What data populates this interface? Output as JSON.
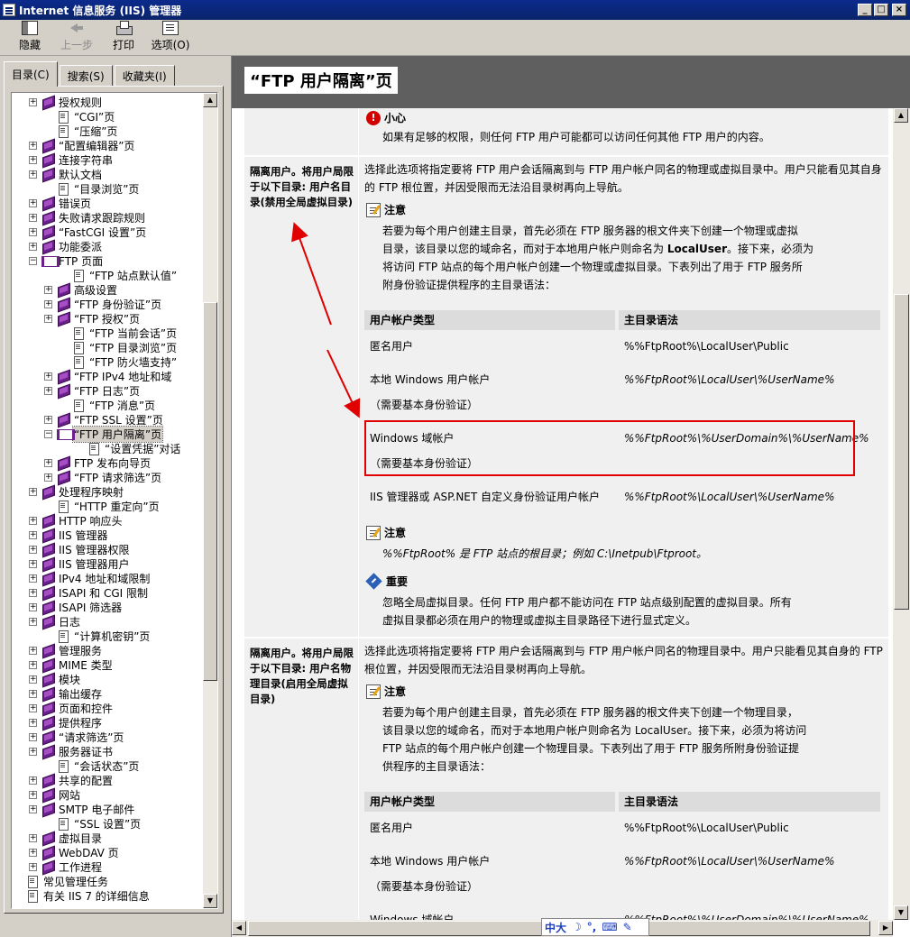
{
  "window": {
    "title": "Internet 信息服务 (IIS) 管理器",
    "min": "_",
    "max": "□",
    "close": "×"
  },
  "toolbar": {
    "hide": "隐藏",
    "back": "上一步",
    "print": "打印",
    "options": "选项(O)"
  },
  "tabs": [
    "目录(C)",
    "搜索(S)",
    "收藏夹(I)"
  ],
  "tree": [
    {
      "l": 3,
      "e": "+",
      "i": "book",
      "t": "授权规则"
    },
    {
      "l": 4,
      "e": "",
      "i": "page",
      "t": "“CGI”页"
    },
    {
      "l": 4,
      "e": "",
      "i": "page",
      "t": "“压缩”页"
    },
    {
      "l": 3,
      "e": "+",
      "i": "book",
      "t": "“配置编辑器”页"
    },
    {
      "l": 3,
      "e": "+",
      "i": "book",
      "t": "连接字符串"
    },
    {
      "l": 3,
      "e": "+",
      "i": "book",
      "t": "默认文档"
    },
    {
      "l": 4,
      "e": "",
      "i": "page",
      "t": "“目录浏览”页"
    },
    {
      "l": 3,
      "e": "+",
      "i": "book",
      "t": "错误页"
    },
    {
      "l": 3,
      "e": "+",
      "i": "book",
      "t": "失败请求跟踪规则"
    },
    {
      "l": 3,
      "e": "+",
      "i": "book",
      "t": "“FastCGI 设置”页"
    },
    {
      "l": 3,
      "e": "+",
      "i": "book",
      "t": "功能委派"
    },
    {
      "l": 3,
      "e": "-",
      "i": "openbook",
      "t": "FTP 页面"
    },
    {
      "l": 5,
      "e": "",
      "i": "page",
      "t": "“FTP 站点默认值”"
    },
    {
      "l": 4,
      "e": "+",
      "i": "book",
      "t": "高级设置"
    },
    {
      "l": 4,
      "e": "+",
      "i": "book",
      "t": "“FTP 身份验证”页"
    },
    {
      "l": 4,
      "e": "+",
      "i": "book",
      "t": "“FTP 授权”页"
    },
    {
      "l": 5,
      "e": "",
      "i": "page",
      "t": "“FTP 当前会话”页"
    },
    {
      "l": 5,
      "e": "",
      "i": "page",
      "t": "“FTP 目录浏览”页"
    },
    {
      "l": 5,
      "e": "",
      "i": "page",
      "t": "“FTP 防火墙支持”"
    },
    {
      "l": 4,
      "e": "+",
      "i": "book",
      "t": "“FTP IPv4 地址和域"
    },
    {
      "l": 4,
      "e": "+",
      "i": "book",
      "t": "“FTP 日志”页"
    },
    {
      "l": 5,
      "e": "",
      "i": "page",
      "t": "“FTP 消息”页"
    },
    {
      "l": 4,
      "e": "+",
      "i": "book",
      "t": "“FTP SSL 设置”页"
    },
    {
      "l": 4,
      "e": "-",
      "i": "openbook",
      "t": "“FTP 用户隔离”页",
      "sel": true
    },
    {
      "l": 6,
      "e": "",
      "i": "page",
      "t": "“设置凭据”对话"
    },
    {
      "l": 4,
      "e": "+",
      "i": "book",
      "t": "FTP 发布向导页"
    },
    {
      "l": 4,
      "e": "+",
      "i": "book",
      "t": "“FTP 请求筛选”页"
    },
    {
      "l": 3,
      "e": "+",
      "i": "book",
      "t": "处理程序映射"
    },
    {
      "l": 4,
      "e": "",
      "i": "page",
      "t": "“HTTP 重定向”页"
    },
    {
      "l": 3,
      "e": "+",
      "i": "book",
      "t": "HTTP 响应头"
    },
    {
      "l": 3,
      "e": "+",
      "i": "book",
      "t": "IIS 管理器"
    },
    {
      "l": 3,
      "e": "+",
      "i": "book",
      "t": "IIS 管理器权限"
    },
    {
      "l": 3,
      "e": "+",
      "i": "book",
      "t": "IIS 管理器用户"
    },
    {
      "l": 3,
      "e": "+",
      "i": "book",
      "t": "IPv4 地址和域限制"
    },
    {
      "l": 3,
      "e": "+",
      "i": "book",
      "t": "ISAPI 和 CGI 限制"
    },
    {
      "l": 3,
      "e": "+",
      "i": "book",
      "t": "ISAPI 筛选器"
    },
    {
      "l": 3,
      "e": "+",
      "i": "book",
      "t": "日志"
    },
    {
      "l": 4,
      "e": "",
      "i": "page",
      "t": "“计算机密钥”页"
    },
    {
      "l": 3,
      "e": "+",
      "i": "book",
      "t": "管理服务"
    },
    {
      "l": 3,
      "e": "+",
      "i": "book",
      "t": "MIME 类型"
    },
    {
      "l": 3,
      "e": "+",
      "i": "book",
      "t": "模块"
    },
    {
      "l": 3,
      "e": "+",
      "i": "book",
      "t": "输出缓存"
    },
    {
      "l": 3,
      "e": "+",
      "i": "book",
      "t": "页面和控件"
    },
    {
      "l": 3,
      "e": "+",
      "i": "book",
      "t": "提供程序"
    },
    {
      "l": 3,
      "e": "+",
      "i": "book",
      "t": "“请求筛选”页"
    },
    {
      "l": 3,
      "e": "+",
      "i": "book",
      "t": "服务器证书"
    },
    {
      "l": 4,
      "e": "",
      "i": "page",
      "t": "“会话状态”页"
    },
    {
      "l": 3,
      "e": "+",
      "i": "book",
      "t": "共享的配置"
    },
    {
      "l": 3,
      "e": "+",
      "i": "book",
      "t": "网站"
    },
    {
      "l": 3,
      "e": "+",
      "i": "book",
      "t": "SMTP 电子邮件"
    },
    {
      "l": 4,
      "e": "",
      "i": "page",
      "t": "“SSL 设置”页"
    },
    {
      "l": 3,
      "e": "+",
      "i": "book",
      "t": "虚拟目录"
    },
    {
      "l": 3,
      "e": "+",
      "i": "book",
      "t": "WebDAV 页"
    },
    {
      "l": 3,
      "e": "+",
      "i": "book",
      "t": "工作进程"
    },
    {
      "l": 2,
      "e": "",
      "i": "page",
      "t": "常见管理任务"
    },
    {
      "l": 2,
      "e": "",
      "i": "page",
      "t": "有关 IIS 7 的详细信息"
    }
  ],
  "content": {
    "title": "“FTP 用户隔离”页",
    "caution": {
      "label": "小心",
      "text": "如果有足够的权限，则任何 FTP 用户可能都可以访问任何其他 FTP 用户的内容。"
    },
    "sec1": {
      "label": "隔离用户。将用户局限于以下目录: 用户名目录(禁用全局虚拟目录)",
      "desc1": "选择此选项将指定要将 FTP 用户会话隔离到与 FTP 用户帐户同名的物理或虚拟目录中。用户只能看见其自身",
      "desc2": "的 FTP 根位置，并因受限而无法沿目录树再向上导航。",
      "note_label": "注意",
      "note1": "若要为每个用户创建主目录，首先必须在 FTP 服务器的根文件夹下创建一个物理或虚拟",
      "note2": "目录，该目录以您的域命名，而对于本地用户帐户则命名为 ",
      "note2b": "LocalUser",
      "note2c": "。接下来，必须为",
      "note3": "将访问 FTP 站点的每个用户帐户创建一个物理或虚拟目录。下表列出了用于 FTP 服务所",
      "note4": "附身份验证提供程序的主目录语法：",
      "col1": "用户帐户类型",
      "col2": "主目录语法",
      "r1a": "匿名用户",
      "r1b": "%%FtpRoot%\\LocalUser\\Public",
      "r2a": "本地 Windows 用户帐户",
      "r2b": "%%FtpRoot%\\LocalUser\\%UserName%",
      "r2c": "（需要基本身份验证）",
      "r3a": "Windows 域帐户",
      "r3b": "%%FtpRoot%\\%UserDomain%\\%UserName%",
      "r3c": "（需要基本身份验证）",
      "r4a": "IIS 管理器或 ASP.NET 自定义身份验证用户帐户",
      "r4b": "%%FtpRoot%\\LocalUser\\%UserName%",
      "note5_label": "注意",
      "note5": "%%FtpRoot% 是 FTP 站点的根目录；例如 C:\\Inetpub\\Ftproot。",
      "imp_label": "重要",
      "imp1": "忽略全局虚拟目录。任何 FTP 用户都不能访问在 FTP 站点级别配置的虚拟目录。所有",
      "imp2": "虚拟目录都必须在用户的物理或虚拟主目录路径下进行显式定义。"
    },
    "sec2": {
      "label": "隔离用户。将用户局限于以下目录: 用户名物理目录(启用全局虚拟目录)",
      "desc1": "选择此选项将指定要将 FTP 用户会话隔离到与 FTP 用户帐户同名的物理目录中。用户只能看见其自身的 FTP",
      "desc2": "根位置，并因受限而无法沿目录树再向上导航。",
      "note_label": "注意",
      "note1": "若要为每个用户创建主目录，首先必须在 FTP 服务器的根文件夹下创建一个物理目录，",
      "note2": "该目录以您的域命名，而对于本地用户帐户则命名为 LocalUser。接下来，必须为将访问",
      "note3": "FTP 站点的每个用户帐户创建一个物理目录。下表列出了用于 FTP 服务所附身份验证提",
      "note4": "供程序的主目录语法：",
      "col1": "用户帐户类型",
      "col2": "主目录语法",
      "r1a": "匿名用户",
      "r1b": "%%FtpRoot%\\LocalUser\\Public",
      "r2a": "本地 Windows 用户帐户",
      "r2b": "%%FtpRoot%\\LocalUser\\%UserName%",
      "r2c": "（需要基本身份验证）",
      "r3a": "Windows 域帐户",
      "r3b": "%%FtpRoot%\\%UserDomain%\\%UserName%"
    }
  },
  "ime": {
    "text": "中大"
  },
  "colors": {
    "titlebar": "#0a246a",
    "highlight": "#e00000",
    "header": "#5f5f5f"
  }
}
